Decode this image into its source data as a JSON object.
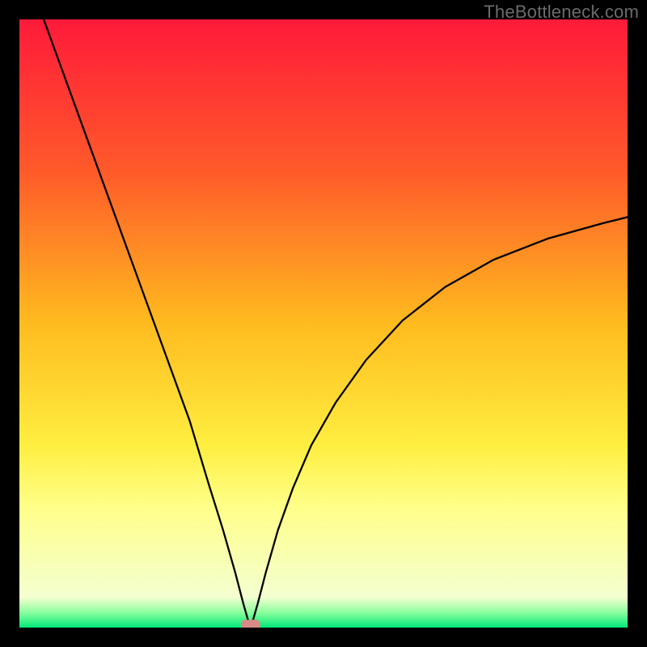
{
  "watermark": "TheBottleneck.com",
  "chart_data": {
    "type": "line",
    "title": "",
    "xlabel": "",
    "ylabel": "",
    "xlim": [
      0,
      100
    ],
    "ylim": [
      0,
      100
    ],
    "grid": false,
    "legend": false,
    "gradient_stops": [
      {
        "pos": 0.0,
        "color": "#ff1a3a"
      },
      {
        "pos": 0.25,
        "color": "#ff5a2a"
      },
      {
        "pos": 0.5,
        "color": "#ffbb1f"
      },
      {
        "pos": 0.7,
        "color": "#ffee40"
      },
      {
        "pos": 0.8,
        "color": "#ffff88"
      },
      {
        "pos": 0.95,
        "color": "#f4ffd0"
      },
      {
        "pos": 0.975,
        "color": "#8cff9e"
      },
      {
        "pos": 1.0,
        "color": "#00e878"
      }
    ],
    "series": [
      {
        "name": "bottleneck-curve",
        "x": [
          4,
          8,
          12,
          16,
          20,
          24,
          28,
          31,
          33.5,
          35.5,
          36.8,
          37.6,
          38,
          38.4,
          39.2,
          40.5,
          42.5,
          45,
          48,
          52,
          57,
          63,
          70,
          78,
          87,
          96,
          100
        ],
        "y": [
          100,
          89,
          78,
          67,
          56,
          45,
          34,
          24,
          16,
          9,
          4,
          1.2,
          0.3,
          1.2,
          4,
          9,
          16,
          23,
          30,
          37,
          44,
          50.5,
          56,
          60.5,
          64,
          66.5,
          67.5
        ]
      }
    ],
    "marker": {
      "name": "optimal-point",
      "x": 38,
      "y": 0.5,
      "width": 3.2,
      "height": 1.6,
      "color": "#d98a86"
    }
  }
}
